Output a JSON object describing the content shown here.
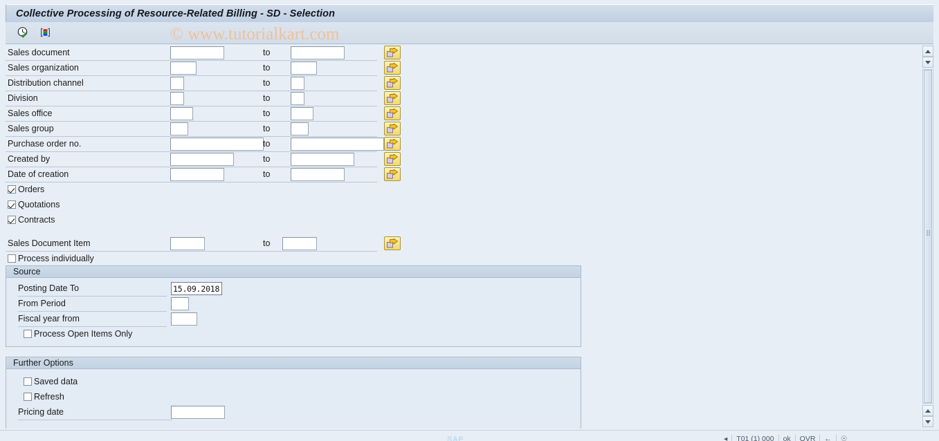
{
  "window": {
    "title": "Collective Processing of Resource-Related Billing - SD - Selection"
  },
  "toolbar": {
    "execute_label": "Execute",
    "variant_label": "Get Variant"
  },
  "watermark": {
    "text": "© www.tutorialkart.com",
    "color": "#f0c09a"
  },
  "selection": {
    "to_label": "to",
    "rows": [
      {
        "label": "Sales document",
        "from": "",
        "to": "",
        "from_w": 78,
        "to_w": 78,
        "msel": true
      },
      {
        "label": "Sales organization",
        "from": "",
        "to": "",
        "from_w": 38,
        "to_w": 38,
        "msel": true
      },
      {
        "label": "Distribution channel",
        "from": "",
        "to": "",
        "from_w": 20,
        "to_w": 20,
        "msel": true
      },
      {
        "label": "Division",
        "from": "",
        "to": "",
        "from_w": 20,
        "to_w": 20,
        "msel": true
      },
      {
        "label": "Sales office",
        "from": "",
        "to": "",
        "from_w": 33,
        "to_w": 33,
        "msel": true
      },
      {
        "label": "Sales group",
        "from": "",
        "to": "",
        "from_w": 26,
        "to_w": 26,
        "msel": true
      },
      {
        "label": "Purchase order no.",
        "from": "",
        "to": "",
        "from_w": 135,
        "to_w": 135,
        "msel": true
      },
      {
        "label": "Created by",
        "from": "",
        "to": "",
        "from_w": 92,
        "to_w": 92,
        "msel": true
      },
      {
        "label": "Date of creation",
        "from": "",
        "to": "",
        "from_w": 78,
        "to_w": 78,
        "msel": true
      }
    ],
    "doc_type_checkboxes": [
      {
        "label": "Orders",
        "checked": true
      },
      {
        "label": "Quotations",
        "checked": true
      },
      {
        "label": "Contracts",
        "checked": true
      }
    ],
    "item_row": {
      "label": "Sales Document Item",
      "from": "",
      "to": "",
      "from_w": 50,
      "to_w": 50,
      "msel": true
    },
    "process_individually": {
      "label": "Process individually",
      "checked": false
    }
  },
  "source_group": {
    "title": "Source",
    "posting_date": {
      "label": "Posting Date To",
      "value": "15.09.2018"
    },
    "from_period": {
      "label": "From Period",
      "value": ""
    },
    "fiscal_year": {
      "label": "Fiscal year from",
      "value": ""
    },
    "open_items": {
      "label": "Process Open Items Only",
      "checked": false
    }
  },
  "further_options_group": {
    "title": "Further Options",
    "saved_data": {
      "label": "Saved data",
      "checked": false
    },
    "refresh": {
      "label": "Refresh",
      "checked": false
    },
    "pricing_date": {
      "label": "Pricing date",
      "value": ""
    }
  },
  "status_bar": {
    "system": "T01 (1) 000",
    "server": "ok",
    "mode": "OVR",
    "sap_logo": "SAP"
  }
}
